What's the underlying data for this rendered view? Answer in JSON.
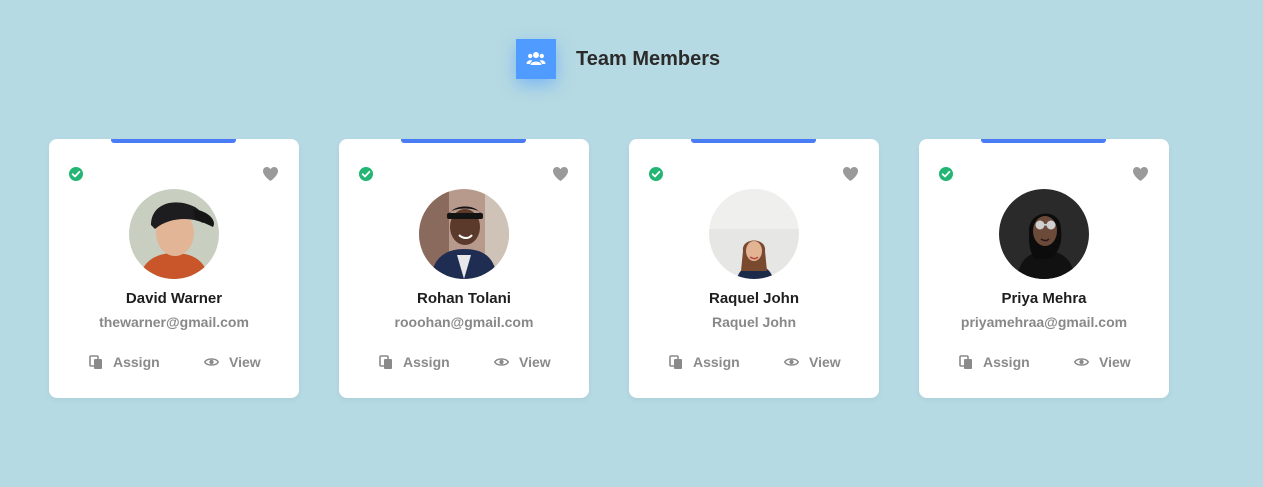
{
  "header": {
    "title": "Team Members",
    "icon": "users-icon",
    "accent_color": "#4f9bff"
  },
  "card_accent_color": "#4a7cf6",
  "status_color": "#22b573",
  "members": [
    {
      "name": "David Warner",
      "email": "thewarner@gmail.com",
      "assign_label": "Assign",
      "view_label": "View",
      "verified": true
    },
    {
      "name": "Rohan Tolani",
      "email": "rooohan@gmail.com",
      "assign_label": "Assign",
      "view_label": "View",
      "verified": true
    },
    {
      "name": "Raquel John",
      "email": "Raquel John",
      "assign_label": "Assign",
      "view_label": "View",
      "verified": true
    },
    {
      "name": "Priya Mehra",
      "email": "priyamehraa@gmail.com",
      "assign_label": "Assign",
      "view_label": "View",
      "verified": true
    }
  ]
}
